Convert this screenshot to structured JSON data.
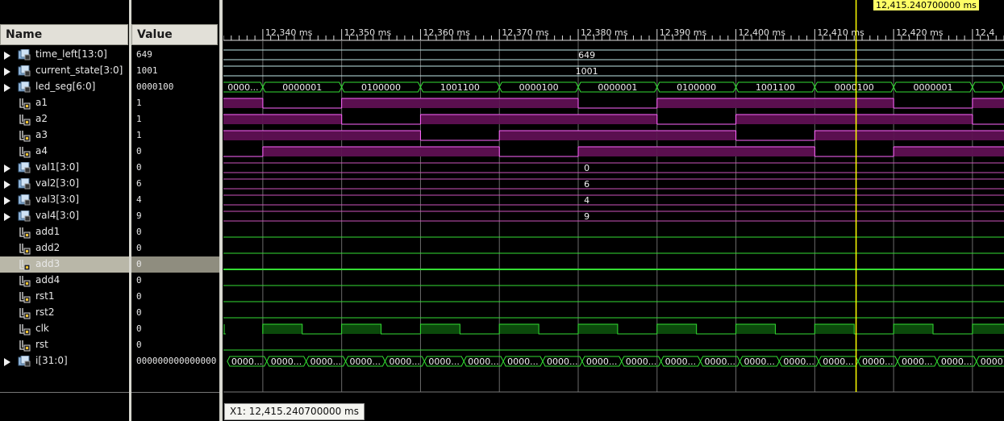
{
  "columns": {
    "name_header": "Name",
    "value_header": "Value"
  },
  "cursor": {
    "label": "12,415.240700000 ms",
    "status": "X1: 12,415.240700000 ms",
    "time": 12415.2407
  },
  "timeline": {
    "t0": 12335,
    "t1": 12434,
    "major_labels": [
      "12,340 ms",
      "12,350 ms",
      "12,360 ms",
      "12,370 ms",
      "12,380 ms",
      "12,390 ms",
      "12,400 ms",
      "12,410 ms",
      "12,420 ms",
      "12,4"
    ],
    "major_times": [
      12340,
      12350,
      12360,
      12370,
      12380,
      12390,
      12400,
      12410,
      12420,
      12430
    ]
  },
  "colors": {
    "bus": "#33dd33",
    "bit": "#33dd33",
    "purple": "#ff66ff",
    "purple_fill": "#5a0f4f",
    "magenta_line": "#cc55bb",
    "cyan_line": "#bfe7e7",
    "green_fill": "#0b4a0b",
    "cursor": "#ffff00",
    "selected": "#b9b7a8"
  },
  "signals": [
    {
      "name": "time_left[13:0]",
      "value": "649",
      "kind": "bus",
      "wave": "const",
      "color": "cyan",
      "text": "649"
    },
    {
      "name": "current_state[3:0]",
      "value": "1001",
      "kind": "bus",
      "wave": "const",
      "color": "cyan",
      "text": "1001"
    },
    {
      "name": "led_seg[6:0]",
      "value": "0000100",
      "kind": "bus",
      "wave": "bus",
      "segments": [
        "0000...",
        "0000001",
        "0100000",
        "1001100",
        "0000100",
        "0000001",
        "0100000",
        "1001100",
        "0000100",
        "0000001",
        ""
      ]
    },
    {
      "name": "a1",
      "value": "1",
      "kind": "bit",
      "wave": "purple",
      "pattern": [
        1,
        0,
        1,
        1,
        1,
        0,
        1,
        1,
        1,
        0,
        1
      ]
    },
    {
      "name": "a2",
      "value": "1",
      "kind": "bit",
      "wave": "purple",
      "pattern": [
        1,
        1,
        0,
        1,
        1,
        1,
        0,
        1,
        1,
        1,
        0
      ]
    },
    {
      "name": "a3",
      "value": "1",
      "kind": "bit",
      "wave": "purple",
      "pattern": [
        1,
        1,
        1,
        0,
        1,
        1,
        1,
        0,
        1,
        1,
        1
      ]
    },
    {
      "name": "a4",
      "value": "0",
      "kind": "bit",
      "wave": "purple",
      "pattern": [
        0,
        1,
        1,
        1,
        0,
        1,
        1,
        1,
        0,
        1,
        1
      ]
    },
    {
      "name": "val1[3:0]",
      "value": "0",
      "kind": "bus",
      "wave": "const",
      "color": "magenta",
      "text": "0"
    },
    {
      "name": "val2[3:0]",
      "value": "6",
      "kind": "bus",
      "wave": "const",
      "color": "magenta",
      "text": "6"
    },
    {
      "name": "val3[3:0]",
      "value": "4",
      "kind": "bus",
      "wave": "const",
      "color": "magenta",
      "text": "4"
    },
    {
      "name": "val4[3:0]",
      "value": "9",
      "kind": "bus",
      "wave": "const",
      "color": "magenta",
      "text": "9"
    },
    {
      "name": "add1",
      "value": "0",
      "kind": "bit",
      "wave": "low"
    },
    {
      "name": "add2",
      "value": "0",
      "kind": "bit",
      "wave": "low"
    },
    {
      "name": "add3",
      "value": "0",
      "kind": "bit",
      "wave": "low",
      "selected": true
    },
    {
      "name": "add4",
      "value": "0",
      "kind": "bit",
      "wave": "low"
    },
    {
      "name": "rst1",
      "value": "0",
      "kind": "bit",
      "wave": "low"
    },
    {
      "name": "rst2",
      "value": "0",
      "kind": "bit",
      "wave": "low"
    },
    {
      "name": "clk",
      "value": "0",
      "kind": "bit",
      "wave": "clk"
    },
    {
      "name": "rst",
      "value": "0",
      "kind": "bit",
      "wave": "low"
    },
    {
      "name": "i[31:0]",
      "value": "000000000000000",
      "kind": "bus",
      "wave": "fastbus",
      "segtext": "0000..."
    }
  ]
}
